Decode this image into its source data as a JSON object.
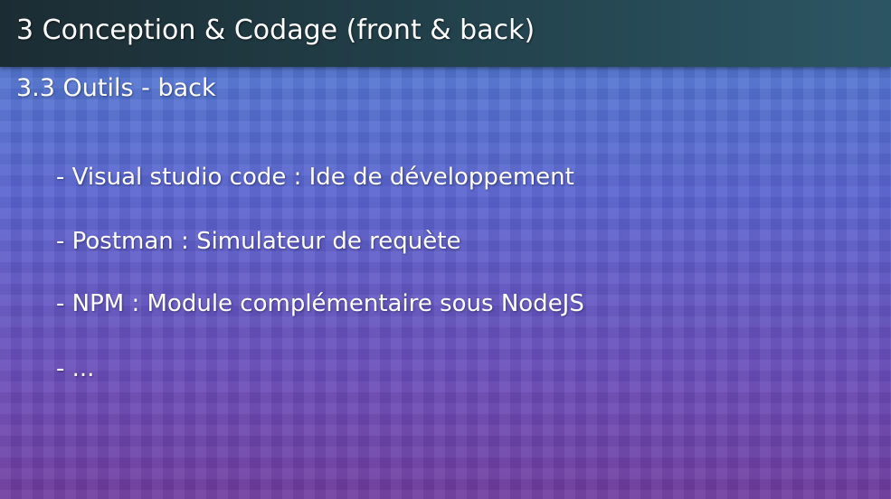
{
  "slide": {
    "title": "3 Conception & Codage (front & back)",
    "subtitle": "3.3 Outils - back",
    "items": [
      "- Visual studio code : Ide de développement",
      "- Postman : Simulateur de requète",
      "- NPM : Module complémentaire sous NodeJS",
      "- ..."
    ]
  },
  "colors": {
    "title_bar": "#22414b",
    "background_top": "#4f7fd1",
    "background_bottom": "#6f3c9f",
    "text": "#ffffff"
  }
}
